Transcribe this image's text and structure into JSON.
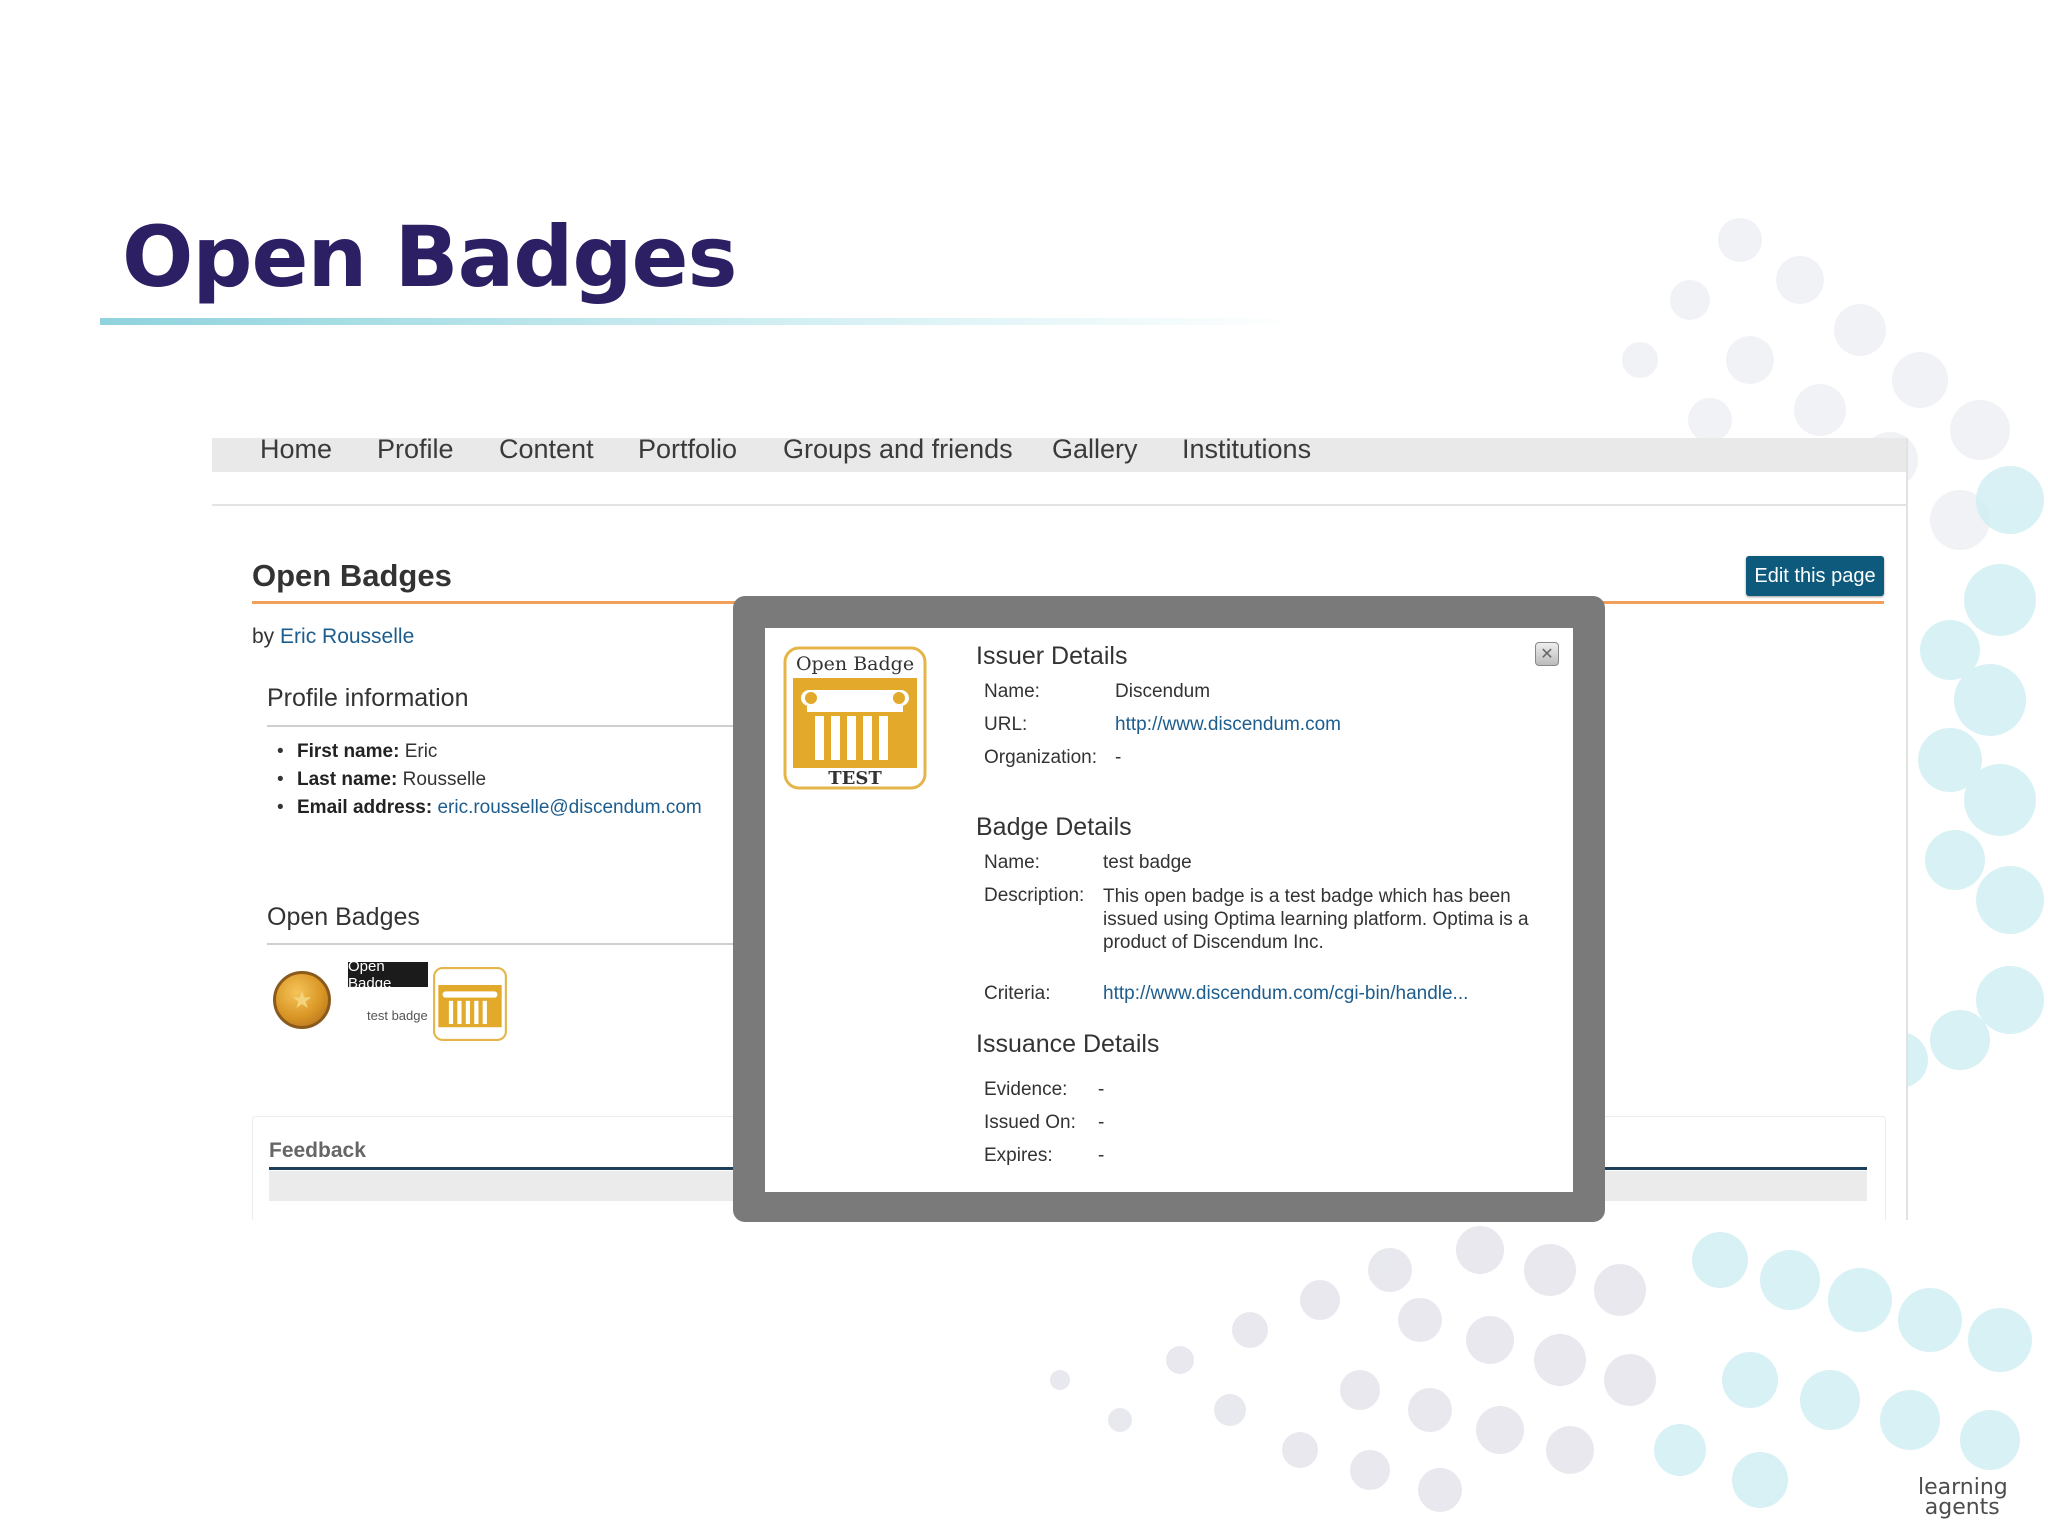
{
  "slide": {
    "title": "Open Badges",
    "logo_line1": "learning",
    "logo_line2": "agents"
  },
  "app": {
    "nav": [
      "Home",
      "Profile",
      "Content",
      "Portfolio",
      "Groups and friends",
      "Gallery",
      "Institutions"
    ],
    "page_title": "Open Badges",
    "edit_button": "Edit this page",
    "byline_prefix": "by",
    "byline_author": "Eric Rousselle",
    "profile_section_title": "Profile information",
    "profile": {
      "first_name_label": "First name:",
      "first_name": "Eric",
      "last_name_label": "Last name:",
      "last_name": "Rousselle",
      "email_label": "Email address:",
      "email": "eric.rousselle@discendum.com"
    },
    "badges_section_title": "Open Badges",
    "badge_tag": "Open Badge",
    "badge_caption": "test badge",
    "feedback_title": "Feedback"
  },
  "modal": {
    "badge_image_title": "Open Badge",
    "badge_image_label": "TEST",
    "issuer_title": "Issuer Details",
    "issuer": {
      "name_label": "Name:",
      "name": "Discendum",
      "url_label": "URL:",
      "url": "http://www.discendum.com",
      "org_label": "Organization:",
      "org": "-"
    },
    "badge_title": "Badge Details",
    "badge": {
      "name_label": "Name:",
      "name": "test badge",
      "desc_label": "Description:",
      "desc": "This open badge is a test badge which has been issued using Optima learning platform. Optima is a product of Discendum Inc.",
      "criteria_label": "Criteria:",
      "criteria": "http://www.discendum.com/cgi-bin/handle..."
    },
    "issuance_title": "Issuance Details",
    "issuance": {
      "evidence_label": "Evidence:",
      "evidence": "-",
      "issued_label": "Issued On:",
      "issued": "-",
      "expires_label": "Expires:",
      "expires": "-"
    }
  },
  "colors": {
    "title": "#2d1f63",
    "link": "#1d5d8e",
    "button": "#0d5a7c",
    "accent_rule": "#f0a058",
    "modal_frame": "#7a7a7a",
    "badge_gold": "#e2a92a"
  }
}
